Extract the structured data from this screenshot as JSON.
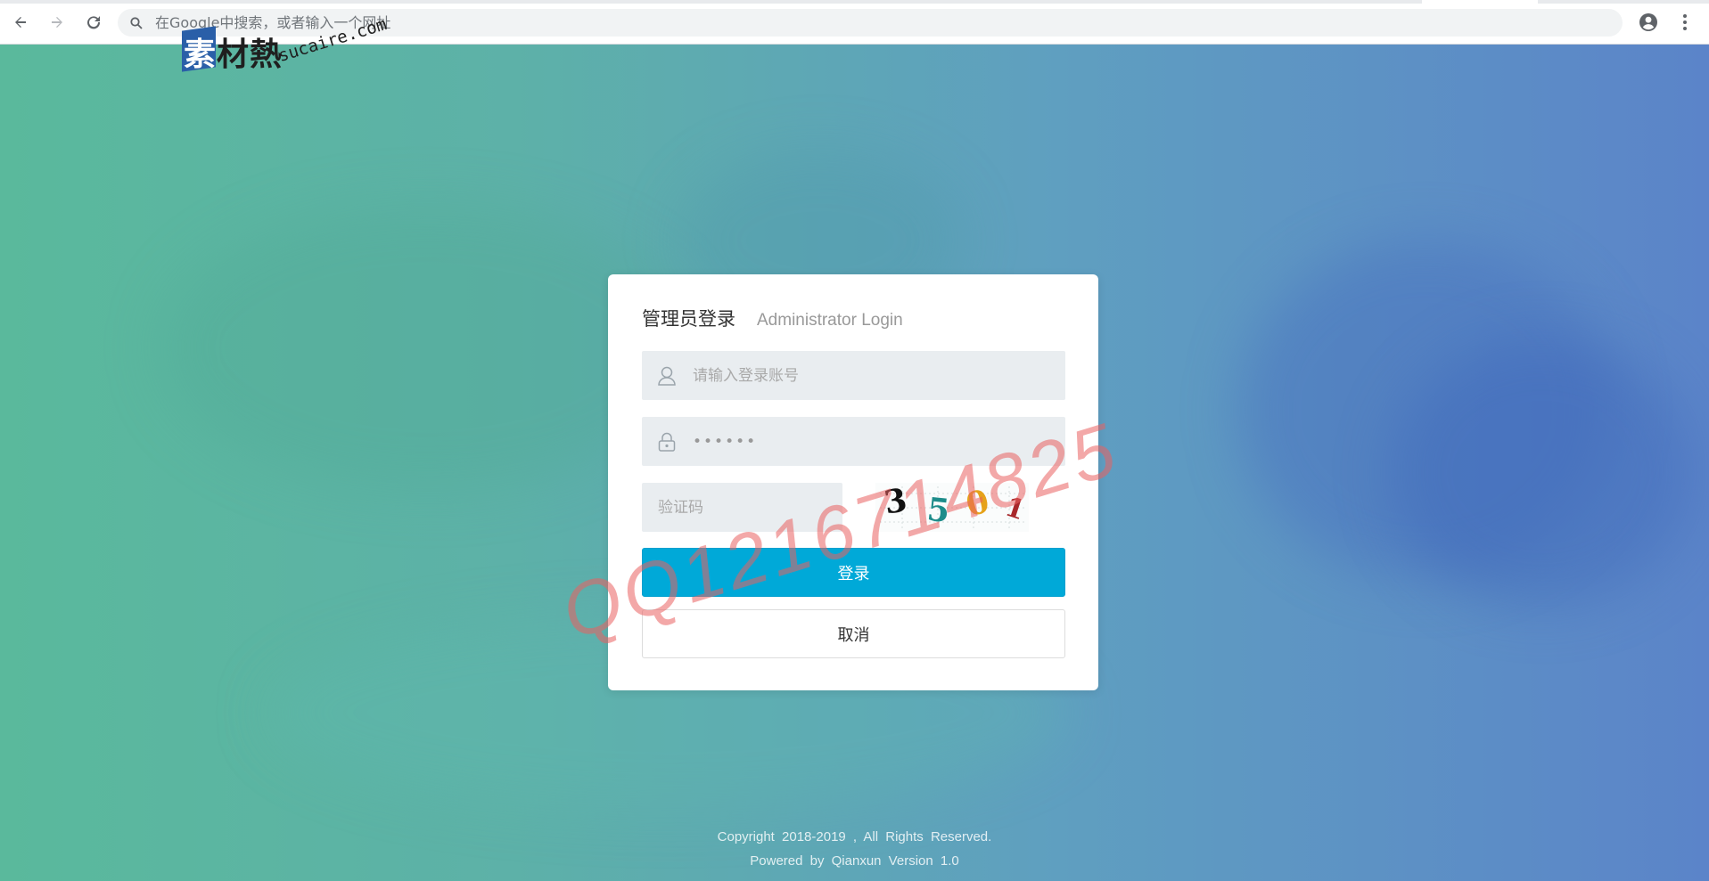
{
  "browser": {
    "omnibox_placeholder": "在Google中搜索，或者输入一个网址"
  },
  "logo": {
    "cn_first": "素",
    "cn_rest": "材熱",
    "en": "sucaire.com"
  },
  "login": {
    "title_cn": "管理员登录",
    "title_en": "Administrator Login",
    "username_placeholder": "请输入登录账号",
    "password_value": "••••••",
    "captcha_placeholder": "验证码",
    "captcha_digits": [
      {
        "char": "3",
        "color": "#111111"
      },
      {
        "char": "5",
        "color": "#1d8c8a"
      },
      {
        "char": "0",
        "color": "#e6a21a"
      },
      {
        "char": "1",
        "color": "#a8282b"
      }
    ],
    "login_button": "登录",
    "cancel_button": "取消"
  },
  "watermark_text": "QQ1216714825",
  "footer": {
    "copyright": "Copyright 2018-2019 , All Rights Reserved.",
    "powered": "Powered by Qianxun Version 1.0"
  },
  "colors": {
    "primary_button": "#00a9d8",
    "input_bg": "#e9edf0"
  },
  "icons": [
    "back-icon",
    "forward-icon",
    "reload-icon",
    "search-icon",
    "profile-icon",
    "menu-icon",
    "user-icon",
    "lock-icon"
  ]
}
